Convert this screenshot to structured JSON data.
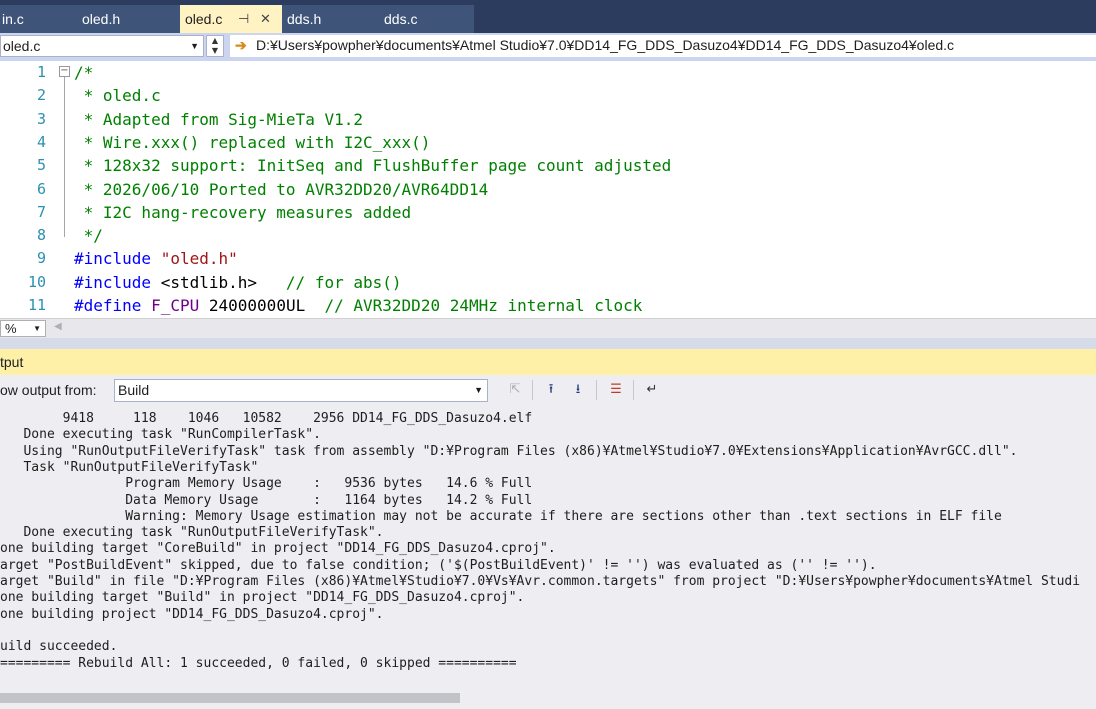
{
  "tabs": [
    {
      "label": "in.c",
      "active": false
    },
    {
      "label": "oled.h",
      "active": false
    },
    {
      "label": "oled.c",
      "active": true
    },
    {
      "label": "dds.h",
      "active": false
    },
    {
      "label": "dds.c",
      "active": false
    }
  ],
  "nav": {
    "file_selector": "oled.c",
    "path": "D:¥Users¥powpher¥documents¥Atmel Studio¥7.0¥DD14_FG_DDS_Dasuzo4¥DD14_FG_DDS_Dasuzo4¥oled.c"
  },
  "editor": {
    "lines": [
      {
        "n": "1",
        "parts": [
          {
            "t": "/*",
            "c": "cmt"
          }
        ]
      },
      {
        "n": "2",
        "parts": [
          {
            "t": " * oled.c",
            "c": "cmt"
          }
        ]
      },
      {
        "n": "3",
        "parts": [
          {
            "t": " * Adapted from Sig-MieTa V1.2",
            "c": "cmt"
          }
        ]
      },
      {
        "n": "4",
        "parts": [
          {
            "t": " * Wire.xxx() replaced with I2C_xxx()",
            "c": "cmt"
          }
        ]
      },
      {
        "n": "5",
        "parts": [
          {
            "t": " * 128x32 support: InitSeq and FlushBuffer page count adjusted",
            "c": "cmt"
          }
        ]
      },
      {
        "n": "6",
        "parts": [
          {
            "t": " * 2026/06/10 Ported to AVR32DD20/AVR64DD14",
            "c": "cmt"
          }
        ]
      },
      {
        "n": "7",
        "parts": [
          {
            "t": " * I2C hang-recovery measures added",
            "c": "cmt"
          }
        ]
      },
      {
        "n": "8",
        "parts": [
          {
            "t": " */",
            "c": "cmt"
          }
        ]
      },
      {
        "n": "9",
        "parts": [
          {
            "t": "#include",
            "c": "pp"
          },
          {
            "t": " ",
            "c": ""
          },
          {
            "t": "\"oled.h\"",
            "c": "str"
          }
        ]
      },
      {
        "n": "10",
        "parts": [
          {
            "t": "#include",
            "c": "pp"
          },
          {
            "t": " <stdlib.h>   ",
            "c": ""
          },
          {
            "t": "// for abs()",
            "c": "cmt"
          }
        ]
      },
      {
        "n": "11",
        "parts": [
          {
            "t": "#define",
            "c": "pp"
          },
          {
            "t": " ",
            "c": ""
          },
          {
            "t": "F_CPU",
            "c": "mac"
          },
          {
            "t": " 24000000UL  ",
            "c": ""
          },
          {
            "t": "// AVR32DD20 24MHz internal clock",
            "c": "cmt"
          }
        ]
      }
    ],
    "zoom": "%"
  },
  "output": {
    "title": "tput",
    "show_from_label": "ow output from:",
    "source": "Build",
    "lines": [
      "        9418     118    1046   10582    2956 DD14_FG_DDS_Dasuzo4.elf",
      "   Done executing task \"RunCompilerTask\".",
      "   Using \"RunOutputFileVerifyTask\" task from assembly \"D:¥Program Files (x86)¥Atmel¥Studio¥7.0¥Extensions¥Application¥AvrGCC.dll\".",
      "   Task \"RunOutputFileVerifyTask\"",
      "                Program Memory Usage    :   9536 bytes   14.6 % Full",
      "                Data Memory Usage       :   1164 bytes   14.2 % Full",
      "                Warning: Memory Usage estimation may not be accurate if there are sections other than .text sections in ELF file",
      "   Done executing task \"RunOutputFileVerifyTask\".",
      "one building target \"CoreBuild\" in project \"DD14_FG_DDS_Dasuzo4.cproj\".",
      "arget \"PostBuildEvent\" skipped, due to false condition; ('$(PostBuildEvent)' != '') was evaluated as ('' != '').",
      "arget \"Build\" in file \"D:¥Program Files (x86)¥Atmel¥Studio¥7.0¥Vs¥Avr.common.targets\" from project \"D:¥Users¥powpher¥documents¥Atmel Studi",
      "one building target \"Build\" in project \"DD14_FG_DDS_Dasuzo4.cproj\".",
      "one building project \"DD14_FG_DDS_Dasuzo4.cproj\".",
      "",
      "uild succeeded.",
      "========= Rebuild All: 1 succeeded, 0 failed, 0 skipped =========="
    ]
  },
  "icons": {
    "path_arrow": "arrow-right-icon",
    "toolbar": [
      "go-to-location-icon",
      "previous-message-icon",
      "next-message-icon",
      "clear-all-icon",
      "word-wrap-icon"
    ]
  },
  "colors": {
    "tab_active": "#fff3c4",
    "tab_bar": "#2b3c5e",
    "comment": "#008000",
    "keyword": "#0000ff",
    "string": "#a31515",
    "macro": "#6f008a",
    "line_number": "#2b91af",
    "output_header": "#fff0a8"
  }
}
